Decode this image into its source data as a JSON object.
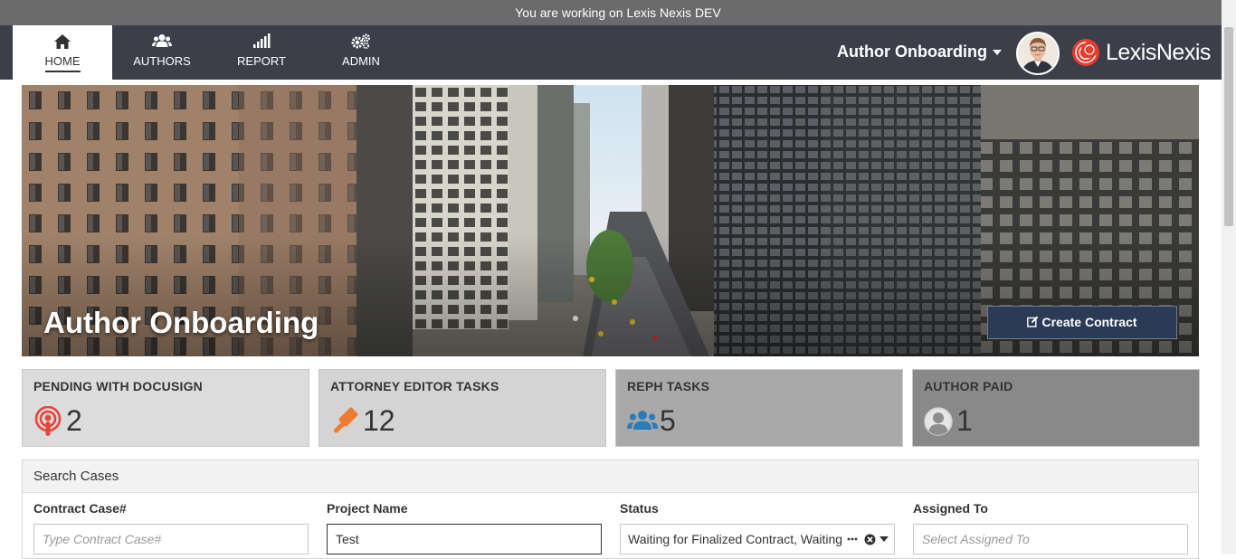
{
  "env_banner": "You are working on Lexis Nexis DEV",
  "nav": {
    "items": [
      {
        "label": "HOME",
        "icon": "home-icon",
        "active": true
      },
      {
        "label": "AUTHORS",
        "icon": "users-icon"
      },
      {
        "label": "REPORT",
        "icon": "signal-bars-icon"
      },
      {
        "label": "ADMIN",
        "icon": "gears-icon"
      }
    ],
    "app_switcher": "Author Onboarding",
    "brand": "LexisNexis"
  },
  "hero": {
    "title": "Author Onboarding",
    "create_button": "Create Contract"
  },
  "cards": [
    {
      "title": "PENDING WITH DOCUSIGN",
      "count": "2",
      "icon": "podcast-icon",
      "icon_color": "#e8443a",
      "bg": "#dcdcdc"
    },
    {
      "title": "ATTORNEY EDITOR TASKS",
      "count": "12",
      "icon": "gavel-icon",
      "icon_color": "#f07a2f",
      "bg": "#d4d4d4"
    },
    {
      "title": "REPH TASKS",
      "count": "5",
      "icon": "users-icon",
      "icon_color": "#2b7bb9",
      "bg": "#a9a9a9"
    },
    {
      "title": "AUTHOR PAID",
      "count": "1",
      "icon": "user-circle-icon",
      "icon_color": "#e0e0e0",
      "bg": "#898989"
    }
  ],
  "search": {
    "header": "Search Cases",
    "fields": {
      "contract_case": {
        "label": "Contract Case#",
        "placeholder": "Type Contract Case#",
        "value": ""
      },
      "project_name": {
        "label": "Project Name",
        "placeholder": "",
        "value": "Test"
      },
      "status": {
        "label": "Status",
        "value": "Waiting for Finalized Contract, Waiting for"
      },
      "assigned_to": {
        "label": "Assigned To",
        "placeholder": "Select Assigned To",
        "value": ""
      }
    }
  }
}
